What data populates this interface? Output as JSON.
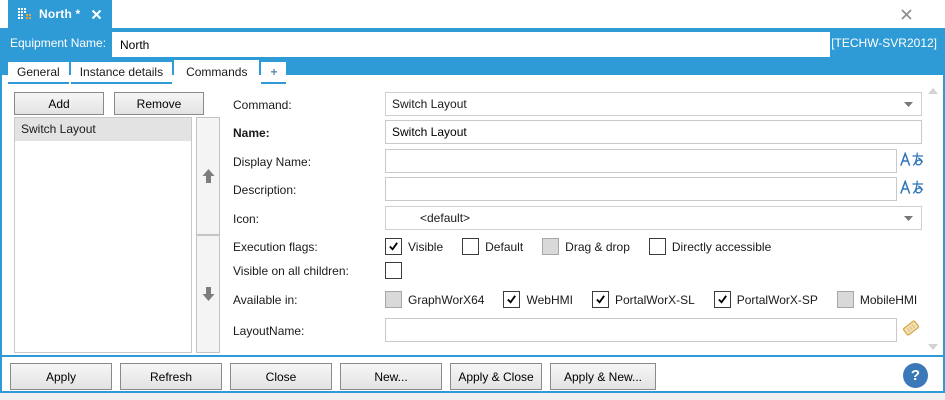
{
  "doc_tab": {
    "title": "North *"
  },
  "window": {
    "close": "x"
  },
  "header": {
    "equipment_label": "Equipment Name:",
    "equipment_value": "North",
    "server": "[TECHW-SVR2012]"
  },
  "tabs": [
    {
      "label": "General",
      "selected": false
    },
    {
      "label": "Instance details",
      "selected": false
    },
    {
      "label": "Commands",
      "selected": true
    },
    {
      "label": "+",
      "selected": false
    }
  ],
  "left_panel": {
    "add_label": "Add",
    "remove_label": "Remove",
    "items": [
      {
        "label": "Switch Layout",
        "selected": true
      }
    ]
  },
  "form": {
    "command": {
      "label": "Command:",
      "value": "Switch Layout"
    },
    "name": {
      "label": "Name:",
      "value": "Switch Layout"
    },
    "display_name": {
      "label": "Display Name:",
      "value": ""
    },
    "description": {
      "label": "Description:",
      "value": ""
    },
    "icon": {
      "label": "Icon:",
      "value": "<default>"
    },
    "execution_flags": {
      "label": "Execution flags:",
      "options": [
        {
          "label": "Visible",
          "state": "checked"
        },
        {
          "label": "Default",
          "state": "unchecked"
        },
        {
          "label": "Drag & drop",
          "state": "disabled"
        },
        {
          "label": "Directly accessible",
          "state": "unchecked"
        }
      ]
    },
    "visible_children": {
      "label": "Visible on all children:",
      "state": "unchecked"
    },
    "available_in": {
      "label": "Available in:",
      "options": [
        {
          "label": "GraphWorX64",
          "state": "disabled"
        },
        {
          "label": "WebHMI",
          "state": "checked"
        },
        {
          "label": "PortalWorX-SL",
          "state": "checked"
        },
        {
          "label": "PortalWorX-SP",
          "state": "checked"
        },
        {
          "label": "MobileHMI",
          "state": "disabled"
        }
      ]
    },
    "layout_name": {
      "label": "LayoutName:",
      "value": ""
    }
  },
  "footer": {
    "buttons": [
      "Apply",
      "Refresh",
      "Close",
      "New...",
      "Apply & Close",
      "Apply & New..."
    ],
    "help": "?"
  },
  "colors": {
    "accent_blue": "#2E9BD6",
    "help_blue": "#3B78B8",
    "localize_blue": "#2E75B6",
    "tag_gold": "#D9A94B",
    "disabled_gray": "#D9D9D9"
  }
}
